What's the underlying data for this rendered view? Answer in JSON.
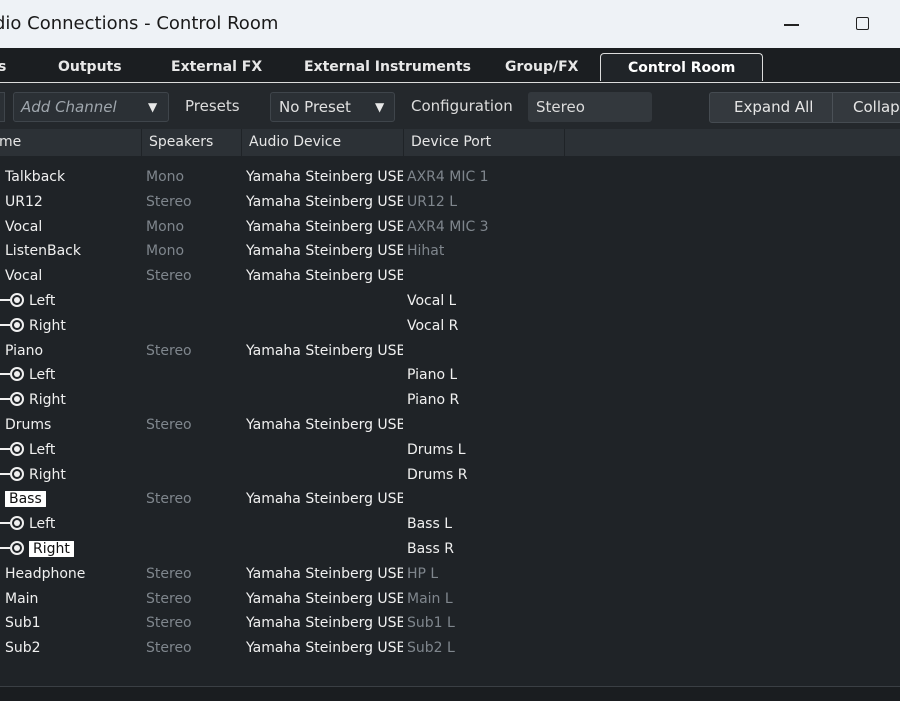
{
  "window": {
    "title": "dio Connections - Control Room"
  },
  "tabs": [
    {
      "label": "s"
    },
    {
      "label": "Outputs"
    },
    {
      "label": "External FX"
    },
    {
      "label": "External Instruments"
    },
    {
      "label": "Group/FX"
    },
    {
      "label": "Control Room",
      "active": true
    }
  ],
  "toolbar": {
    "add_channel_placeholder": "Add Channel",
    "presets_label": "Presets",
    "preset_value": "No Preset",
    "configuration_label": "Configuration",
    "configuration_value": "Stereo",
    "expand_all": "Expand All",
    "collapse_all": "Collaps"
  },
  "columns": [
    "me",
    "Speakers",
    "Audio Device",
    "Device Port"
  ],
  "rows": [
    {
      "name": "Talkback",
      "speakers": "Mono",
      "device": "Yamaha Steinberg USB ASIO",
      "port": "AXR4 MIC 1"
    },
    {
      "name": "UR12",
      "speakers": "Stereo",
      "device": "Yamaha Steinberg USB ASIO",
      "port": "UR12 L"
    },
    {
      "name": "Vocal",
      "speakers": "Mono",
      "device": "Yamaha Steinberg USB ASIO",
      "port": "AXR4 MIC 3"
    },
    {
      "name": "ListenBack",
      "speakers": "Mono",
      "device": "Yamaha Steinberg USB ASIO",
      "port": "Hihat"
    },
    {
      "name": "Vocal",
      "speakers": "Stereo",
      "device": "Yamaha Steinberg USB ASIO",
      "port": ""
    },
    {
      "name": "Left",
      "speakers": "",
      "device": "",
      "port": "Vocal L",
      "sub": true
    },
    {
      "name": "Right",
      "speakers": "",
      "device": "",
      "port": "Vocal R",
      "sub": true
    },
    {
      "name": "Piano",
      "speakers": "Stereo",
      "device": "Yamaha Steinberg USB ASIO",
      "port": ""
    },
    {
      "name": "Left",
      "speakers": "",
      "device": "",
      "port": "Piano L",
      "sub": true
    },
    {
      "name": "Right",
      "speakers": "",
      "device": "",
      "port": "Piano R",
      "sub": true
    },
    {
      "name": "Drums",
      "speakers": "Stereo",
      "device": "Yamaha Steinberg USB ASIO",
      "port": ""
    },
    {
      "name": "Left",
      "speakers": "",
      "device": "",
      "port": "Drums L",
      "sub": true
    },
    {
      "name": "Right",
      "speakers": "",
      "device": "",
      "port": "Drums R",
      "sub": true
    },
    {
      "name": "Bass",
      "speakers": "Stereo",
      "device": "Yamaha Steinberg USB ASIO",
      "port": "",
      "highlight": true
    },
    {
      "name": "Left",
      "speakers": "",
      "device": "",
      "port": "Bass L",
      "sub": true
    },
    {
      "name": "Right",
      "speakers": "",
      "device": "",
      "port": "Bass R",
      "sub": true,
      "highlight": true
    },
    {
      "name": "Headphone",
      "speakers": "Stereo",
      "device": "Yamaha Steinberg USB ASIO",
      "port": "HP L"
    },
    {
      "name": "Main",
      "speakers": "Stereo",
      "device": "Yamaha Steinberg USB ASIO",
      "port": "Main L"
    },
    {
      "name": "Sub1",
      "speakers": "Stereo",
      "device": "Yamaha Steinberg USB ASIO",
      "port": "Sub1 L"
    },
    {
      "name": "Sub2",
      "speakers": "Stereo",
      "device": "Yamaha Steinberg USB ASIO",
      "port": "Sub2 L"
    }
  ]
}
